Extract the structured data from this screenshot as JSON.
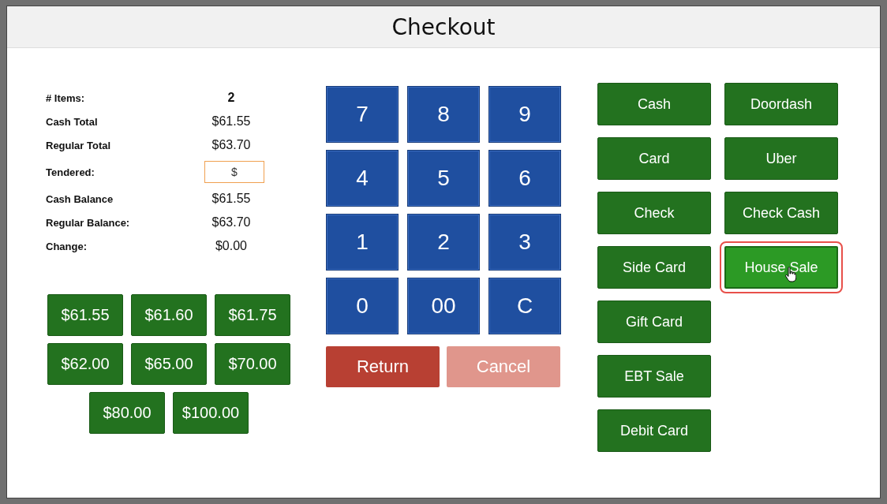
{
  "dialog": {
    "title": "Checkout"
  },
  "summary": [
    {
      "label": "# Items:",
      "value": "2",
      "kind": "count"
    },
    {
      "label": "Cash Total",
      "value": "$61.55",
      "kind": "text"
    },
    {
      "label": "Regular Total",
      "value": "$63.70",
      "kind": "text"
    },
    {
      "label": "Tendered:",
      "value": "$",
      "kind": "input"
    },
    {
      "label": "Cash Balance",
      "value": "$61.55",
      "kind": "text"
    },
    {
      "label": "Regular Balance:",
      "value": "$63.70",
      "kind": "text"
    },
    {
      "label": "Change:",
      "value": "$0.00",
      "kind": "text"
    }
  ],
  "quick_amounts": [
    [
      "$61.55",
      "$61.60",
      "$61.75"
    ],
    [
      "$62.00",
      "$65.00",
      "$70.00"
    ],
    [
      "$80.00",
      "$100.00"
    ]
  ],
  "keypad": [
    "7",
    "8",
    "9",
    "4",
    "5",
    "6",
    "1",
    "2",
    "3",
    "0",
    "00",
    "C"
  ],
  "actions": [
    {
      "label": "Return",
      "kind": "return"
    },
    {
      "label": "Cancel",
      "kind": "cancel"
    }
  ],
  "payment_methods": [
    [
      {
        "label": "Cash",
        "selected": false
      },
      {
        "label": "Card",
        "selected": false
      },
      {
        "label": "Check",
        "selected": false
      },
      {
        "label": "Side Card",
        "selected": false
      },
      {
        "label": "Gift Card",
        "selected": false
      },
      {
        "label": "EBT Sale",
        "selected": false
      },
      {
        "label": "Debit Card",
        "selected": false
      }
    ],
    [
      {
        "label": "Doordash",
        "selected": false
      },
      {
        "label": "Uber",
        "selected": false
      },
      {
        "label": "Check Cash",
        "selected": false
      },
      {
        "label": "House Sale",
        "selected": true
      }
    ]
  ]
}
